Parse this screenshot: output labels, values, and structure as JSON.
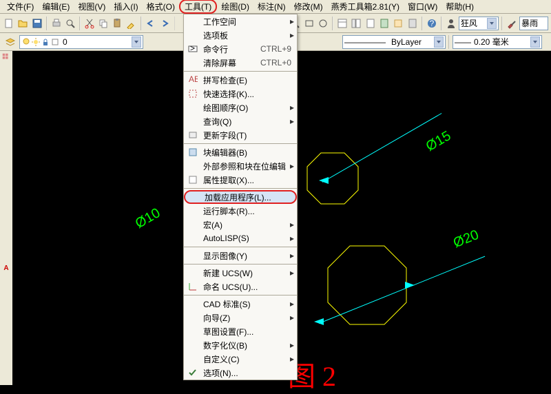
{
  "menubar": {
    "file": "文件(F)",
    "edit": "编辑(E)",
    "view": "视图(V)",
    "insert": "插入(I)",
    "format": "格式(O)",
    "tools": "工具(T)",
    "draw": "绘图(D)",
    "annotate": "标注(N)",
    "modify": "修改(M)",
    "yanxiu": "燕秀工具箱2.81(Y)",
    "window": "窗口(W)",
    "help": "帮助(H)"
  },
  "toolbar1": {
    "style_combo": "狂风",
    "style_combo2": "暴雨"
  },
  "toolbar2": {
    "layer": "0",
    "linetype": "ByLayer",
    "lineweight": "0.20 毫米"
  },
  "tools_menu": {
    "workspace": "工作空间",
    "palette": "选项板",
    "cmdline": "命令行",
    "cmdline_sc": "CTRL+9",
    "clearscreen": "清除屏幕",
    "clearscreen_sc": "CTRL+0",
    "spellcheck": "拼写检查(E)",
    "quickselect": "快速选择(K)...",
    "draworder": "绘图顺序(O)",
    "query": "查询(Q)",
    "updatefield": "更新字段(T)",
    "blockeditor": "块编辑器(B)",
    "xref": "外部参照和块在位编辑",
    "attrextract": "属性提取(X)...",
    "loadapp": "加载应用程序(L)...",
    "runscript": "运行脚本(R)...",
    "macro": "宏(A)",
    "autolisp": "AutoLISP(S)",
    "showimg": "显示图像(Y)",
    "newucs": "新建 UCS(W)",
    "nameucs": "命名 UCS(U)...",
    "cadstd": "CAD 标准(S)",
    "wizard": "向导(Z)",
    "sketch": "草图设置(F)...",
    "digitizer": "数字化仪(B)",
    "customize": "自定义(C)",
    "options": "选项(N)..."
  },
  "drawing": {
    "dim15": "Ø15",
    "dim10": "Ø10",
    "dim20": "Ø20"
  },
  "figure_label": "图 2"
}
